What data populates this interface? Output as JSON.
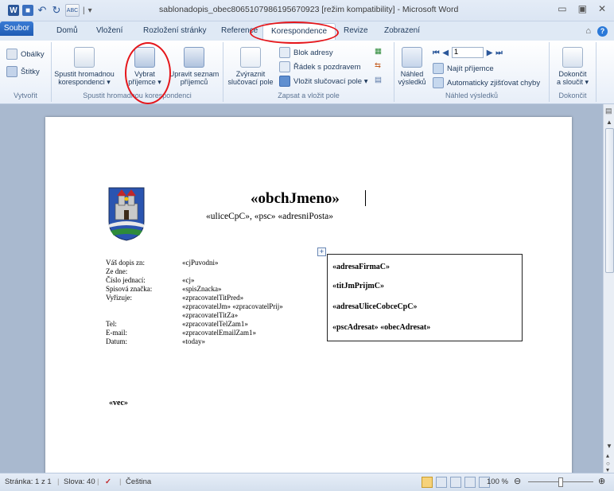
{
  "window": {
    "title": "sablonadopis_obec8065107986195670923 [režim kompatibility] - Microsoft Word"
  },
  "qat": {
    "app_icon": "word-icon",
    "separator": "|"
  },
  "tabs": {
    "file": "Soubor",
    "home": "Domů",
    "insert": "Vložení",
    "layout": "Rozložení stránky",
    "references": "Reference",
    "mailings": "Korespondence",
    "review": "Revize",
    "view": "Zobrazení"
  },
  "ribbon": {
    "create": {
      "label": "Vytvořit",
      "envelopes": "Obálky",
      "labels": "Štítky"
    },
    "start": {
      "label": "Spustit hromadnou korespondenci",
      "start_merge_1": "Spustit hromadnou",
      "start_merge_2": "korespondenci ▾",
      "select_recipients_1": "Vybrat",
      "select_recipients_2": "příjemce ▾",
      "edit_list_1": "Upravit seznam",
      "edit_list_2": "příjemců"
    },
    "write": {
      "label": "Zapsat a vložit pole",
      "highlight_1": "Zvýraznit",
      "highlight_2": "slučovací pole",
      "address_block": "Blok adresy",
      "greeting_line": "Řádek s pozdravem",
      "insert_field": "Vložit slučovací pole ▾"
    },
    "preview": {
      "label": "Náhled výsledků",
      "preview_1": "Náhled",
      "preview_2": "výsledků",
      "record": "1",
      "find": "Najít příjemce",
      "check": "Automaticky zjišťovat chyby"
    },
    "finish": {
      "label": "Dokončit",
      "finish_1": "Dokončit",
      "finish_2": "a sloučit ▾"
    }
  },
  "doc": {
    "header_name": "«obchJmeno»",
    "header_address": "«uliceCpC»,  «psc» «adresniPosta»",
    "fields": [
      {
        "label": "Váš dopis zn:",
        "value": "«cjPuvodni»"
      },
      {
        "label": "Ze dne:",
        "value": ""
      },
      {
        "label": "Číslo jednací:",
        "value": "«cj»"
      },
      {
        "label": "Spisová značka:",
        "value": "«spisZnacka»"
      },
      {
        "label": "Vyřizuje:",
        "value": "«zpracovatelTitPred»"
      },
      {
        "label": "",
        "value": "«zpracovatelJm» «zpracovatelPrij»"
      },
      {
        "label": "",
        "value": "«zpracovatelTitZa»"
      },
      {
        "label": "Tel:",
        "value": "«zpracovatelTelZam1»"
      },
      {
        "label": "E-mail:",
        "value": "«zpracovatelEmailZam1»"
      },
      {
        "label": "Datum:",
        "value": "«today»"
      }
    ],
    "address_box": [
      "«adresaFirmaC»",
      "«titJmPrijmC»",
      "«adresaUliceCobceCpC»",
      "«pscAdresat» «obecAdresat»"
    ],
    "subject": "«vec»",
    "table_handle": "+"
  },
  "status": {
    "page": "Stránka: 1 z 1",
    "words": "Slova: 40",
    "language": "Čeština",
    "zoom": "100 %"
  },
  "colors": {
    "accent": "#2b579a",
    "highlight_oval": "#e5161b",
    "doc_background": "#a9b9cf"
  }
}
